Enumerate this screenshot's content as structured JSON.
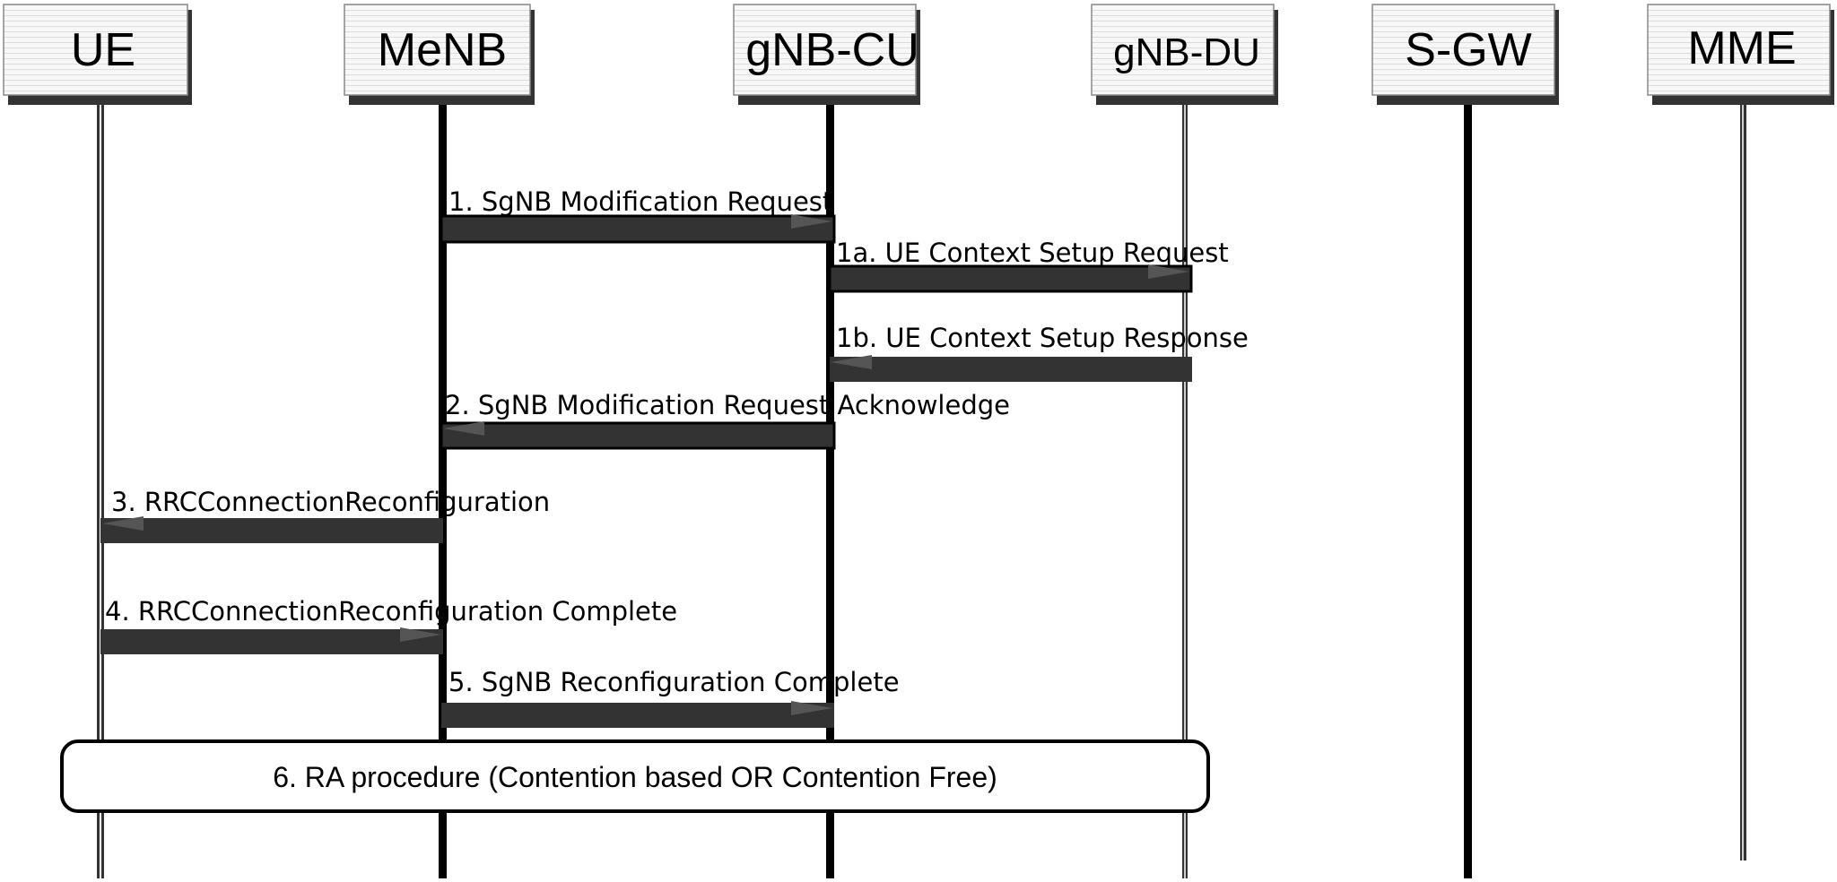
{
  "entities": [
    {
      "id": "ue",
      "name": "UE"
    },
    {
      "id": "menb",
      "name": "MeNB"
    },
    {
      "id": "gnb-cu",
      "name": "gNB-CU"
    },
    {
      "id": "gnb-du",
      "name": "gNB-DU"
    },
    {
      "id": "s-gw",
      "name": "S-GW"
    },
    {
      "id": "mme",
      "name": "MME"
    }
  ],
  "messages": [
    {
      "label": "1. SgNB Modification  Request",
      "from": "menb",
      "to": "gnb-cu"
    },
    {
      "label": "1a. UE Context Setup  Request",
      "from": "gnb-cu",
      "to": "gnb-du"
    },
    {
      "label": "1b. UE Context Setup  Response",
      "from": "gnb-du",
      "to": "gnb-cu"
    },
    {
      "label": "2. SgNB Modification Request  Acknowledge",
      "from": "gnb-cu",
      "to": "menb"
    },
    {
      "label": "3. RRCConnectionReconfiguration",
      "from": "menb",
      "to": "ue"
    },
    {
      "label": "4. RRCConnectionReconfiguration  Complete",
      "from": "ue",
      "to": "menb"
    },
    {
      "label": "5. SgNB Reconfiguration Complete",
      "from": "menb",
      "to": "gnb-cu"
    }
  ],
  "procedure_box": {
    "label": "6. RA procedure (Contention based OR Contention Free)"
  },
  "colors": {
    "arrow": "#333333",
    "lifeline": "#333333",
    "box_border": "#000000",
    "header_fill": "#f4f4f4",
    "header_shadow": "#333333"
  }
}
